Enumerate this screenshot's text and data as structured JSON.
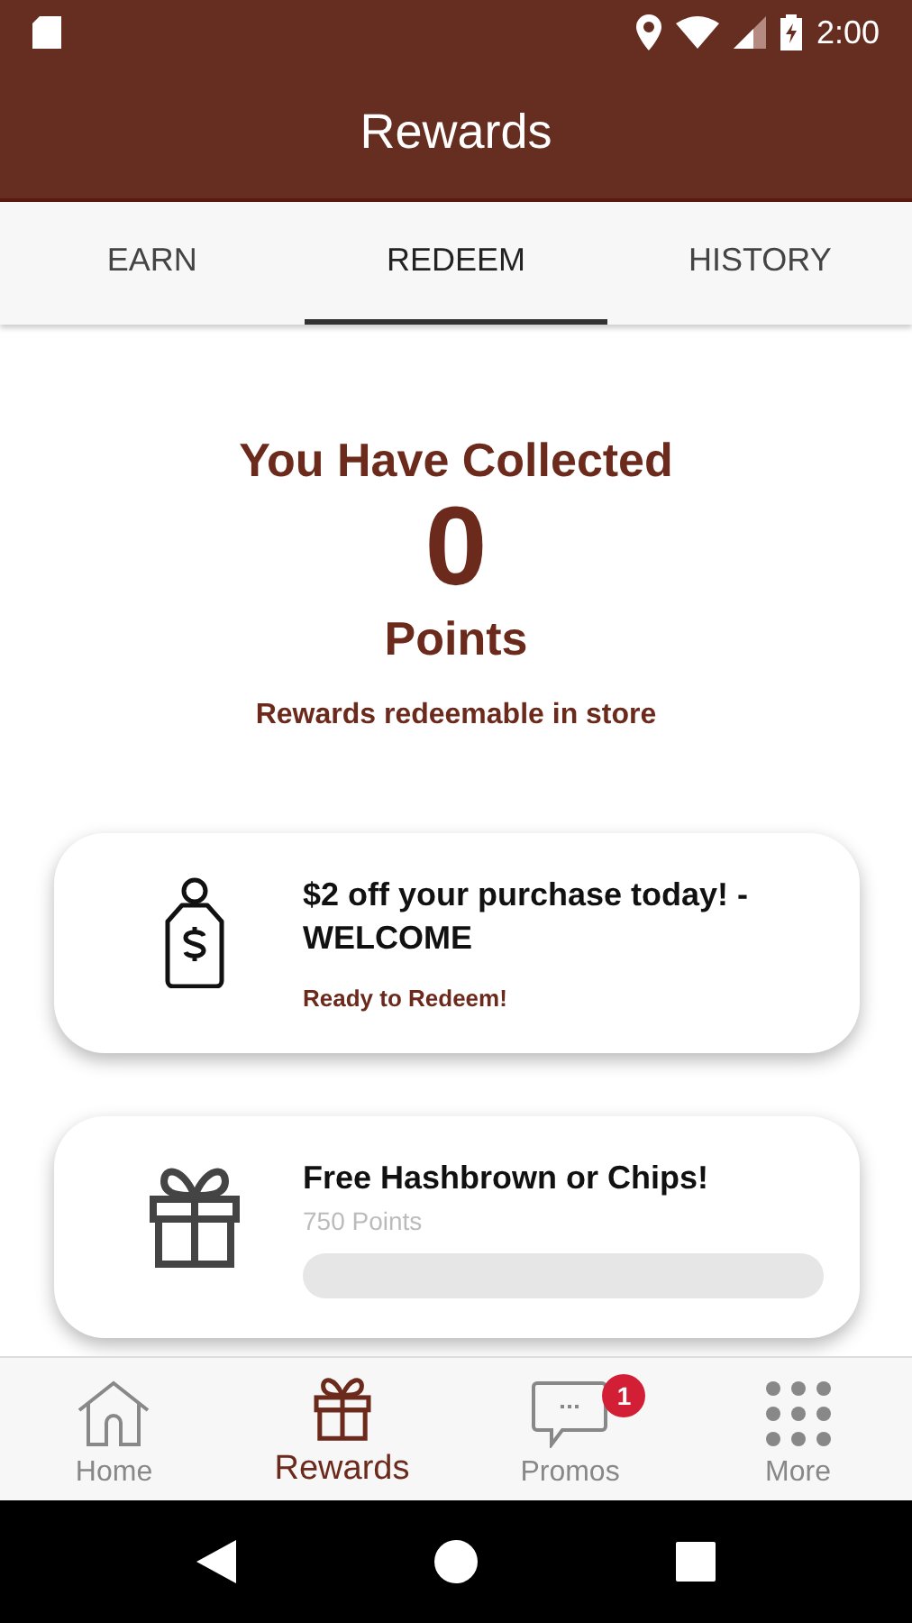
{
  "status_bar": {
    "time": "2:00"
  },
  "app_bar": {
    "title": "Rewards"
  },
  "tabs": [
    {
      "label": "EARN",
      "selected": false
    },
    {
      "label": "REDEEM",
      "selected": true
    },
    {
      "label": "HISTORY",
      "selected": false
    }
  ],
  "summary": {
    "heading": "You Have Collected",
    "points": "0",
    "unit": "Points",
    "note": "Rewards redeemable in store"
  },
  "rewards": [
    {
      "kind": "ready",
      "title": "$2 off your purchase today! - WELCOME",
      "status": "Ready to Redeem!"
    },
    {
      "kind": "progress",
      "title": "Free Hashbrown or Chips!",
      "cost": "750 Points",
      "level": 0
    }
  ],
  "bottom_nav": [
    {
      "label": "Home",
      "kind": "home",
      "selected": false
    },
    {
      "label": "Rewards",
      "kind": "gift",
      "selected": true
    },
    {
      "label": "Promos",
      "kind": "chat",
      "selected": false,
      "badge": "1"
    },
    {
      "label": "More",
      "kind": "grid",
      "selected": false
    }
  ]
}
